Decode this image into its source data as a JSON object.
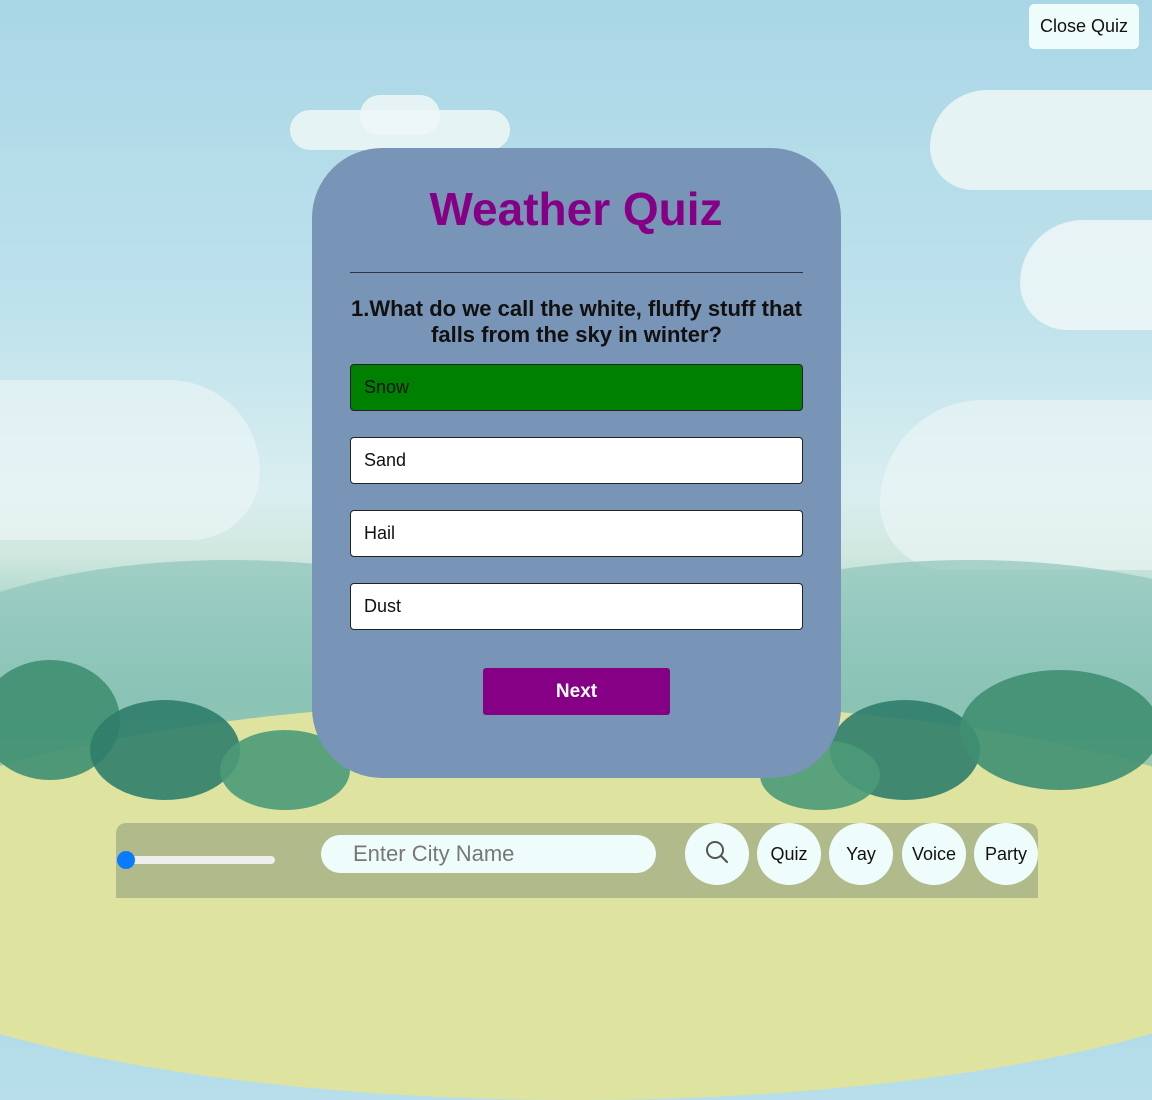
{
  "header": {
    "close_label": "Close Quiz"
  },
  "quiz": {
    "title": "Weather Quiz",
    "question": "1.What do we call the white, fluffy stuff that falls from the sky in winter?",
    "answers": [
      {
        "label": "Snow",
        "state": "correct"
      },
      {
        "label": "Sand",
        "state": "default"
      },
      {
        "label": "Hail",
        "state": "default"
      },
      {
        "label": "Dust",
        "state": "default"
      }
    ],
    "next_label": "Next"
  },
  "toolbar": {
    "slider_value": 0,
    "search_placeholder": "Enter City Name",
    "search_icon": "search-icon",
    "buttons": {
      "quiz": "Quiz",
      "yay": "Yay",
      "voice": "Voice",
      "party": "Party"
    }
  },
  "colors": {
    "title": "#850085",
    "card": "#7894b6",
    "correct": "#008000",
    "next_button": "#850085",
    "slider": "#0a7bff",
    "button_bg": "#eefdfc"
  }
}
